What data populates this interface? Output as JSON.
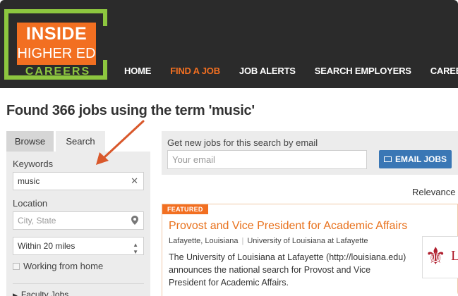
{
  "brand": {
    "line1": "INSIDE",
    "line2": "HIGHER ED",
    "sub": "CAREERS",
    "colors": {
      "orange": "#f26f21",
      "green": "#8dc63f",
      "header_bg": "#2b2b2b",
      "link_blue": "#3a77b5"
    }
  },
  "nav": {
    "items": [
      {
        "label": "HOME",
        "active": false
      },
      {
        "label": "FIND A JOB",
        "active": true
      },
      {
        "label": "JOB ALERTS",
        "active": false
      },
      {
        "label": "SEARCH EMPLOYERS",
        "active": false
      },
      {
        "label": "CAREER A",
        "active": false
      }
    ]
  },
  "page": {
    "title": "Found 366 jobs using the term 'music'"
  },
  "sidebar": {
    "tabs": [
      {
        "label": "Browse"
      },
      {
        "label": "Search"
      }
    ],
    "keywords": {
      "label": "Keywords",
      "value": "music",
      "clear_icon": "close-icon"
    },
    "location": {
      "label": "Location",
      "placeholder": "City, State",
      "icon": "map-pin-icon"
    },
    "radius": {
      "selected": "Within 20 miles"
    },
    "remote": {
      "label": "Working from home",
      "checked": false
    },
    "facet": {
      "label": "Faculty Jobs"
    }
  },
  "alert": {
    "label": "Get new jobs for this search by email",
    "placeholder": "Your email",
    "button": "EMAIL JOBS"
  },
  "sort": {
    "label": "Relevance"
  },
  "job": {
    "badge": "FEATURED",
    "title": "Provost and Vice President for Academic Affairs",
    "location": "Lafayette, Louisiana",
    "employer": "University of Louisiana at Lafayette",
    "description": "The University of Louisiana at Lafayette (http://louisiana.edu) announces the national search for Provost and Vice President for Academic Affairs.",
    "logo_icon": "fleur-de-lis-icon"
  }
}
